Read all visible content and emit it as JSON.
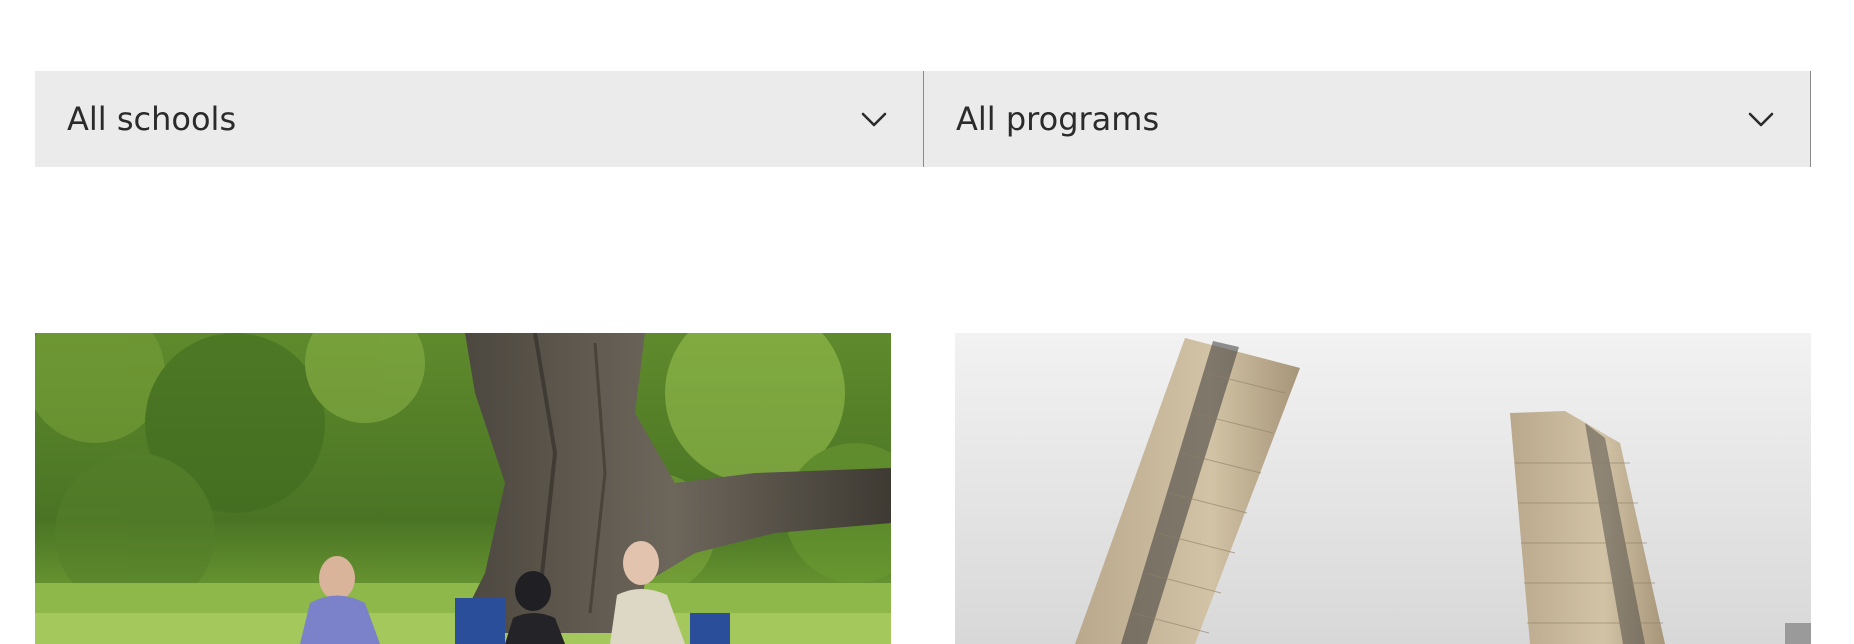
{
  "filters": {
    "school_select": {
      "value": "All schools",
      "icon": "chevron-down-icon"
    },
    "program_select": {
      "value": "All programs",
      "icon": "chevron-down-icon"
    }
  },
  "cards": [
    {
      "image": "people-under-tree-photo"
    },
    {
      "image": "residential-towers-photo"
    }
  ],
  "colors": {
    "select_background": "#ebebeb",
    "select_text": "#2b2b2b",
    "divider": "#8a8a8a"
  }
}
